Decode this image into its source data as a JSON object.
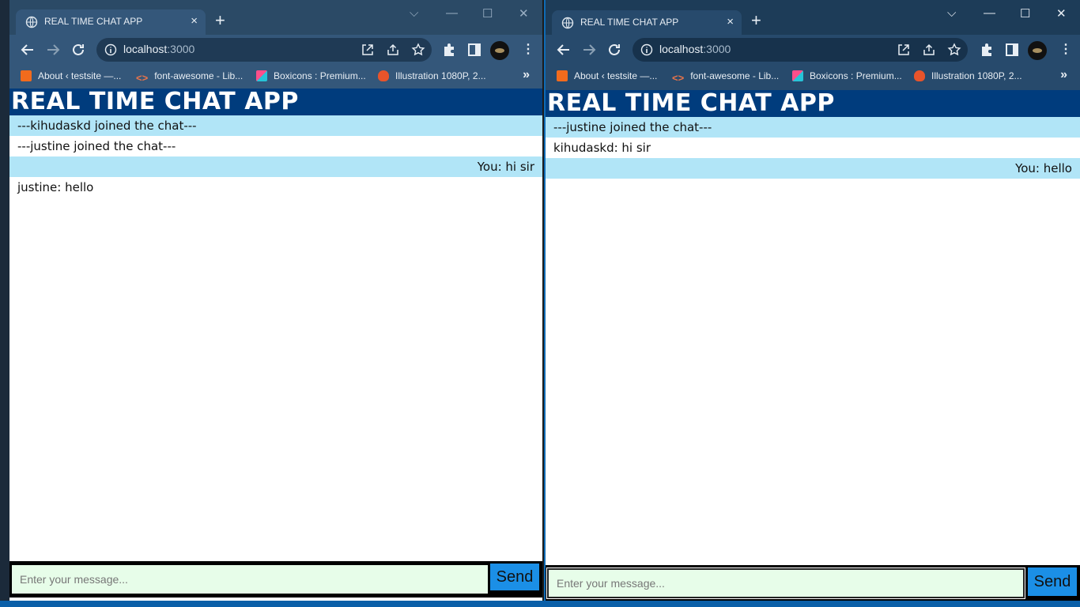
{
  "browser": {
    "tab_title": "REAL TIME CHAT APP",
    "tab_close": "×",
    "new_tab": "+",
    "url_host": "localhost",
    "url_port": ":3000",
    "bookmarks": [
      {
        "label": "About ‹ testsite —...",
        "color": "#f26b1d"
      },
      {
        "label": "font-awesome - Lib...",
        "color": "#e8744a"
      },
      {
        "label": "Boxicons : Premium...",
        "color": "#ff4f8b"
      },
      {
        "label": "Illustration 1080P, 2...",
        "color": "#e8542b"
      }
    ],
    "bookmarks_more": "»",
    "menu": "⋮"
  },
  "window_controls": {
    "dropdown": "⌵",
    "minimize": "—",
    "maximize": "☐",
    "close": "✕"
  },
  "left_window": {
    "app_title": "REAL TIME CHAT APP",
    "messages": [
      {
        "text": "---kihudaskd joined the chat---",
        "style": "shade"
      },
      {
        "text": "---justine joined the chat---",
        "style": "plain"
      },
      {
        "text": "You: hi sir",
        "style": "shade-right"
      },
      {
        "text": "justine: hello",
        "style": "plain"
      }
    ],
    "input_placeholder": "Enter your message...",
    "send_label": "Send"
  },
  "right_window": {
    "app_title": "REAL TIME CHAT APP",
    "messages": [
      {
        "text": "---justine joined the chat---",
        "style": "shade"
      },
      {
        "text": "kihudaskd: hi sir",
        "style": "plain"
      },
      {
        "text": "You: hello",
        "style": "shade-right"
      }
    ],
    "input_placeholder": "Enter your message...",
    "send_label": "Send"
  },
  "colors": {
    "app_header": "#003c7d",
    "message_highlight": "#b1e5f7",
    "input_bg": "#e7fde9",
    "send_button": "#1b8fe6"
  }
}
